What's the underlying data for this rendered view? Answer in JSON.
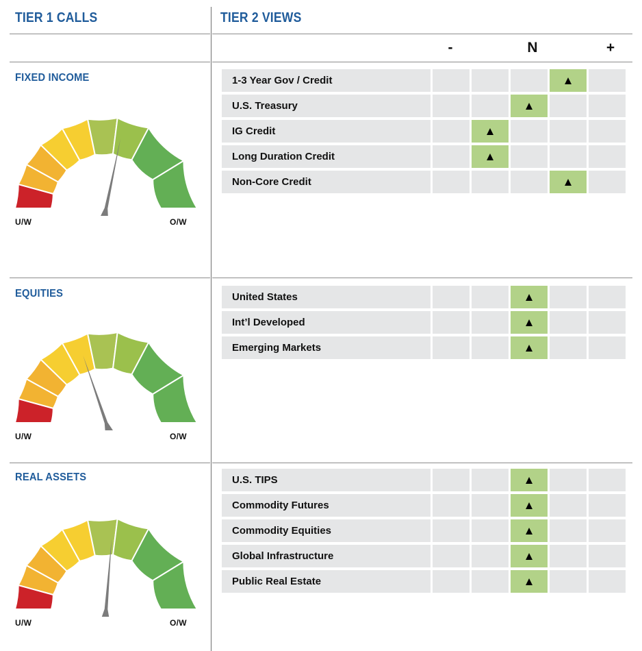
{
  "header": {
    "tier1_title": "TIER 1 CALLS",
    "tier2_title": "TIER 2 VIEWS"
  },
  "column_headers": {
    "underweight": "-",
    "neutral": "N",
    "overweight": "+"
  },
  "gauge_labels": {
    "left": "U/W",
    "right": "O/W"
  },
  "marker_glyph": "▲",
  "colors": {
    "brand_blue": "#205C9B",
    "cell_gray": "#E5E6E7",
    "marker_green": "#B2D288",
    "rule_gray": "#8C8C8C",
    "gauge_red": "#CC2229",
    "gauge_orange": "#F2B332",
    "gauge_yellow": "#F6CE31",
    "gauge_yellow_green": "#A9C253",
    "gauge_light_green": "#9BC04C",
    "gauge_green": "#63AF55",
    "needle_gray": "#7C7C7C"
  },
  "sections": [
    {
      "id": "fixed-income",
      "title": "FIXED INCOME",
      "gauge": {
        "needle_value": 0.565,
        "label_left": "U/W",
        "label_right": "O/W"
      },
      "rows": [
        {
          "label": "1-3 Year Gov / Credit",
          "marked_index": 3
        },
        {
          "label": "U.S. Treasury",
          "marked_index": 2
        },
        {
          "label": "IG Credit",
          "marked_index": 1
        },
        {
          "label": "Long Duration Credit",
          "marked_index": 1
        },
        {
          "label": "Non-Core Credit",
          "marked_index": 3
        }
      ]
    },
    {
      "id": "equities",
      "title": "EQUITIES",
      "gauge": {
        "needle_value": 0.395,
        "label_left": "U/W",
        "label_right": "O/W"
      },
      "rows": [
        {
          "label": "United States",
          "marked_index": 2
        },
        {
          "label": "Int’l Developed",
          "marked_index": 2
        },
        {
          "label": "Emerging Markets",
          "marked_index": 2
        }
      ]
    },
    {
      "id": "real-assets",
      "title": "REAL ASSETS",
      "gauge": {
        "needle_value": 0.525,
        "label_left": "U/W",
        "label_right": "O/W"
      },
      "rows": [
        {
          "label": "U.S. TIPS",
          "marked_index": 2
        },
        {
          "label": "Commodity Futures",
          "marked_index": 2
        },
        {
          "label": "Commodity Equities",
          "marked_index": 2
        },
        {
          "label": "Global Infrastructure",
          "marked_index": 2
        },
        {
          "label": "Public Real Estate",
          "marked_index": 2
        }
      ]
    }
  ],
  "chart_data": {
    "type": "table",
    "title": "Tier 1 Calls / Tier 2 Views",
    "columns": [
      "View",
      "-",
      "",
      "N",
      "",
      "+"
    ],
    "gauge_scale": {
      "min_label": "U/W",
      "max_label": "O/W",
      "segments": 8
    },
    "series": [
      {
        "name": "FIXED INCOME",
        "gauge_position": 0.565,
        "values": [
          {
            "x": "1-3 Year Gov / Credit",
            "y": 4
          },
          {
            "x": "U.S. Treasury",
            "y": 3
          },
          {
            "x": "IG Credit",
            "y": 2
          },
          {
            "x": "Long Duration Credit",
            "y": 2
          },
          {
            "x": "Non-Core Credit",
            "y": 4
          }
        ]
      },
      {
        "name": "EQUITIES",
        "gauge_position": 0.395,
        "values": [
          {
            "x": "United States",
            "y": 3
          },
          {
            "x": "Int’l Developed",
            "y": 3
          },
          {
            "x": "Emerging Markets",
            "y": 3
          }
        ]
      },
      {
        "name": "REAL ASSETS",
        "gauge_position": 0.525,
        "values": [
          {
            "x": "U.S. TIPS",
            "y": 3
          },
          {
            "x": "Commodity Futures",
            "y": 3
          },
          {
            "x": "Commodity Equities",
            "y": 3
          },
          {
            "x": "Global Infrastructure",
            "y": 3
          },
          {
            "x": "Public Real Estate",
            "y": 3
          }
        ]
      }
    ]
  }
}
